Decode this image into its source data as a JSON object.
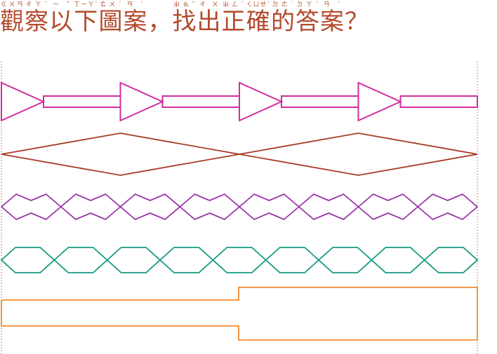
{
  "question": {
    "segments": [
      {
        "ch": "觀",
        "bopomofo": "ㄍㄨㄢ"
      },
      {
        "ch": "察",
        "bopomofo": "ㄔㄚˊ"
      },
      {
        "ch": "以",
        "bopomofo": "ㄧˇ"
      },
      {
        "ch": "下",
        "bopomofo": "ㄒㄧㄚˋ"
      },
      {
        "ch": "圖",
        "bopomofo": "ㄊㄨˊ"
      },
      {
        "ch": "案",
        "bopomofo": "ㄢˋ"
      },
      {
        "ch": "，",
        "bopomofo": ""
      },
      {
        "ch": "找",
        "bopomofo": "ㄓㄠˇ"
      },
      {
        "ch": "出",
        "bopomofo": "ㄔㄨ"
      },
      {
        "ch": "正",
        "bopomofo": "ㄓㄥˋ"
      },
      {
        "ch": "確",
        "bopomofo": "ㄑㄩㄝˋ"
      },
      {
        "ch": "的",
        "bopomofo": "ㄉㄜ˙"
      },
      {
        "ch": "答",
        "bopomofo": "ㄉㄚˊ"
      },
      {
        "ch": "案",
        "bopomofo": "ㄢˋ"
      },
      {
        "ch": "？",
        "bopomofo": ""
      }
    ]
  },
  "colors": {
    "text": "#b34a2c",
    "row1": "#d22d9e",
    "row2": "#a63a25",
    "row3": "#9a33a8",
    "row4": "#169a82",
    "row5": "#f08a2c",
    "guides": "#b34a2c"
  },
  "figure": {
    "rows": [
      {
        "pattern": "arrow-chain",
        "repeats": 4
      },
      {
        "pattern": "diamond-chain",
        "repeats": 2
      },
      {
        "pattern": "zigzag-chain",
        "repeats": 8
      },
      {
        "pattern": "octagon-chain",
        "repeats": 9
      },
      {
        "pattern": "step-outline",
        "repeats": 1
      }
    ]
  }
}
